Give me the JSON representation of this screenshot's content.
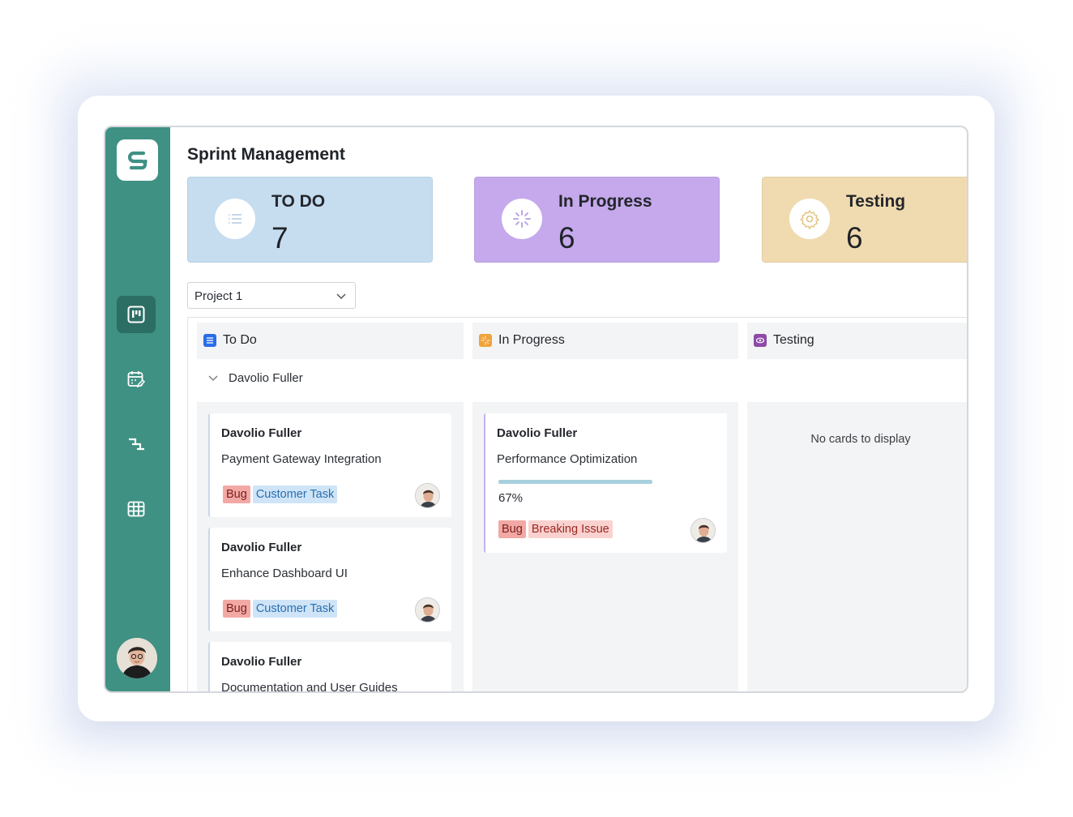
{
  "page_title": "Sprint Management",
  "stats": [
    {
      "label": "TO DO",
      "count": "7",
      "color": "#c6ddf0",
      "icon": "list-icon"
    },
    {
      "label": "In Progress",
      "count": "6",
      "color": "#c5a9ec",
      "icon": "loading-spinner-icon"
    },
    {
      "label": "Testing",
      "count": "6",
      "color": "#f0dbb0",
      "icon": "gear-icon"
    }
  ],
  "project_select": {
    "value": "Project 1"
  },
  "columns": [
    {
      "title": "To Do",
      "icon_color": "#2b6de8"
    },
    {
      "title": "In Progress",
      "icon_color": "#f0a33a"
    },
    {
      "title": "Testing",
      "icon_color": "#8d4aa8"
    }
  ],
  "swimlane": {
    "title": "Davolio Fuller"
  },
  "todo_cards": [
    {
      "assignee": "Davolio Fuller",
      "summary": "Payment Gateway Integration",
      "tags": [
        "Bug",
        "Customer Task"
      ]
    },
    {
      "assignee": "Davolio Fuller",
      "summary": "Enhance Dashboard UI",
      "tags": [
        "Bug",
        "Customer Task"
      ]
    },
    {
      "assignee": "Davolio Fuller",
      "summary": "Documentation and User Guides",
      "tags": []
    }
  ],
  "inprogress_cards": [
    {
      "assignee": "Davolio Fuller",
      "summary": "Performance Optimization",
      "progress": "67%",
      "progress_value": 0.67,
      "tags": [
        "Bug",
        "Breaking Issue"
      ]
    }
  ],
  "testing_empty": "No cards to display",
  "colors": {
    "sidebar": "#3f9183",
    "sidebar_active": "#2c6e63"
  }
}
